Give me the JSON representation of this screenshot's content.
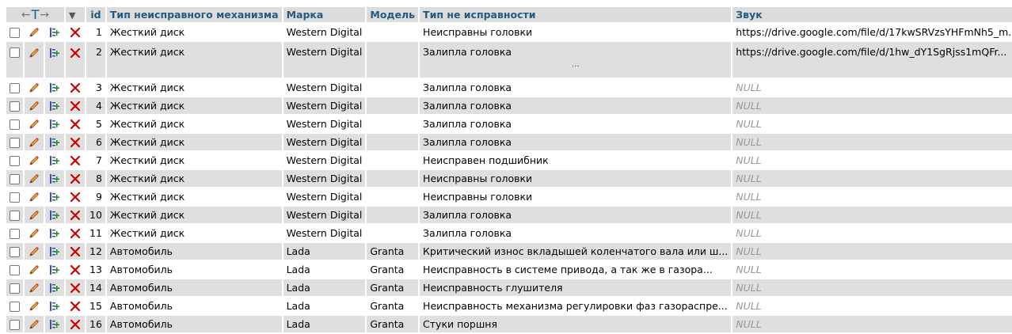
{
  "header": {
    "left_arrow": "←",
    "t_glyph": "T",
    "right_arrow": "→",
    "dropdown": "▼",
    "columns": [
      "id",
      "Тип неисправного механизма",
      "Марка",
      "Модель",
      "Тип не исправности",
      "Звук"
    ]
  },
  "icons": {
    "edit": "pencil-icon",
    "copy": "copy-row-icon",
    "delete": "delete-x-icon"
  },
  "colors": {
    "header_text": "#235a81",
    "header_bg": "#dcdcdc",
    "row_even_bg": "#dfdfdf",
    "delete_red": "#cc0000"
  },
  "rows": [
    {
      "id": "1",
      "mech": "Жесткий диск",
      "brand": "Western Digital",
      "model": "",
      "fault": "Неисправны головки",
      "sound": "https://drive.google.com/file/d/17kwSRVzsYHFmNh5_m...",
      "extra": ""
    },
    {
      "id": "2",
      "mech": "Жесткий диск",
      "brand": "Western Digital",
      "model": "",
      "fault": "Залипла головка",
      "sound": "https://drive.google.com/file/d/1hw_dY1SgRjss1mQFr...",
      "extra": "..."
    },
    {
      "id": "3",
      "mech": "Жесткий диск",
      "brand": "Western Digital",
      "model": "",
      "fault": "Залипла головка",
      "sound": "NULL"
    },
    {
      "id": "4",
      "mech": "Жесткий диск",
      "brand": "Western Digital",
      "model": "",
      "fault": "Залипла головка",
      "sound": "NULL"
    },
    {
      "id": "5",
      "mech": "Жесткий диск",
      "brand": "Western Digital",
      "model": "",
      "fault": "Залипла головка",
      "sound": "NULL"
    },
    {
      "id": "6",
      "mech": "Жесткий диск",
      "brand": "Western Digital",
      "model": "",
      "fault": "Залипла головка",
      "sound": "NULL"
    },
    {
      "id": "7",
      "mech": "Жесткий диск",
      "brand": "Western Digital",
      "model": "",
      "fault": "Неисправен подшибник",
      "sound": "NULL"
    },
    {
      "id": "8",
      "mech": "Жесткий диск",
      "brand": "Western Digital",
      "model": "",
      "fault": "Неисправны головки",
      "sound": "NULL"
    },
    {
      "id": "9",
      "mech": "Жесткий диск",
      "brand": "Western Digital",
      "model": "",
      "fault": "Неисправны головки",
      "sound": "NULL"
    },
    {
      "id": "10",
      "mech": "Жесткий диск",
      "brand": "Western Digital",
      "model": "",
      "fault": "Залипла головка",
      "sound": "NULL"
    },
    {
      "id": "11",
      "mech": "Жесткий диск",
      "brand": "Western Digital",
      "model": "",
      "fault": "Залипла головка",
      "sound": "NULL"
    },
    {
      "id": "12",
      "mech": "Автомобиль",
      "brand": "Lada",
      "model": "Granta",
      "fault": "Критический износ вкладышей коленчатого вала или ш...",
      "sound": "NULL"
    },
    {
      "id": "13",
      "mech": "Автомобиль",
      "brand": "Lada",
      "model": "Granta",
      "fault": "Неисправность в системе привода, а так же в газора...",
      "sound": "NULL"
    },
    {
      "id": "14",
      "mech": "Автомобиль",
      "brand": "Lada",
      "model": "Granta",
      "fault": "Неисправность глушителя",
      "sound": "NULL"
    },
    {
      "id": "15",
      "mech": "Автомобиль",
      "brand": "Lada",
      "model": "Granta",
      "fault": "Неисправность механизма регулировки фаз газораспре...",
      "sound": "NULL"
    },
    {
      "id": "16",
      "mech": "Автомобиль",
      "brand": "Lada",
      "model": "Granta",
      "fault": "Стуки поршня",
      "sound": "NULL"
    }
  ]
}
